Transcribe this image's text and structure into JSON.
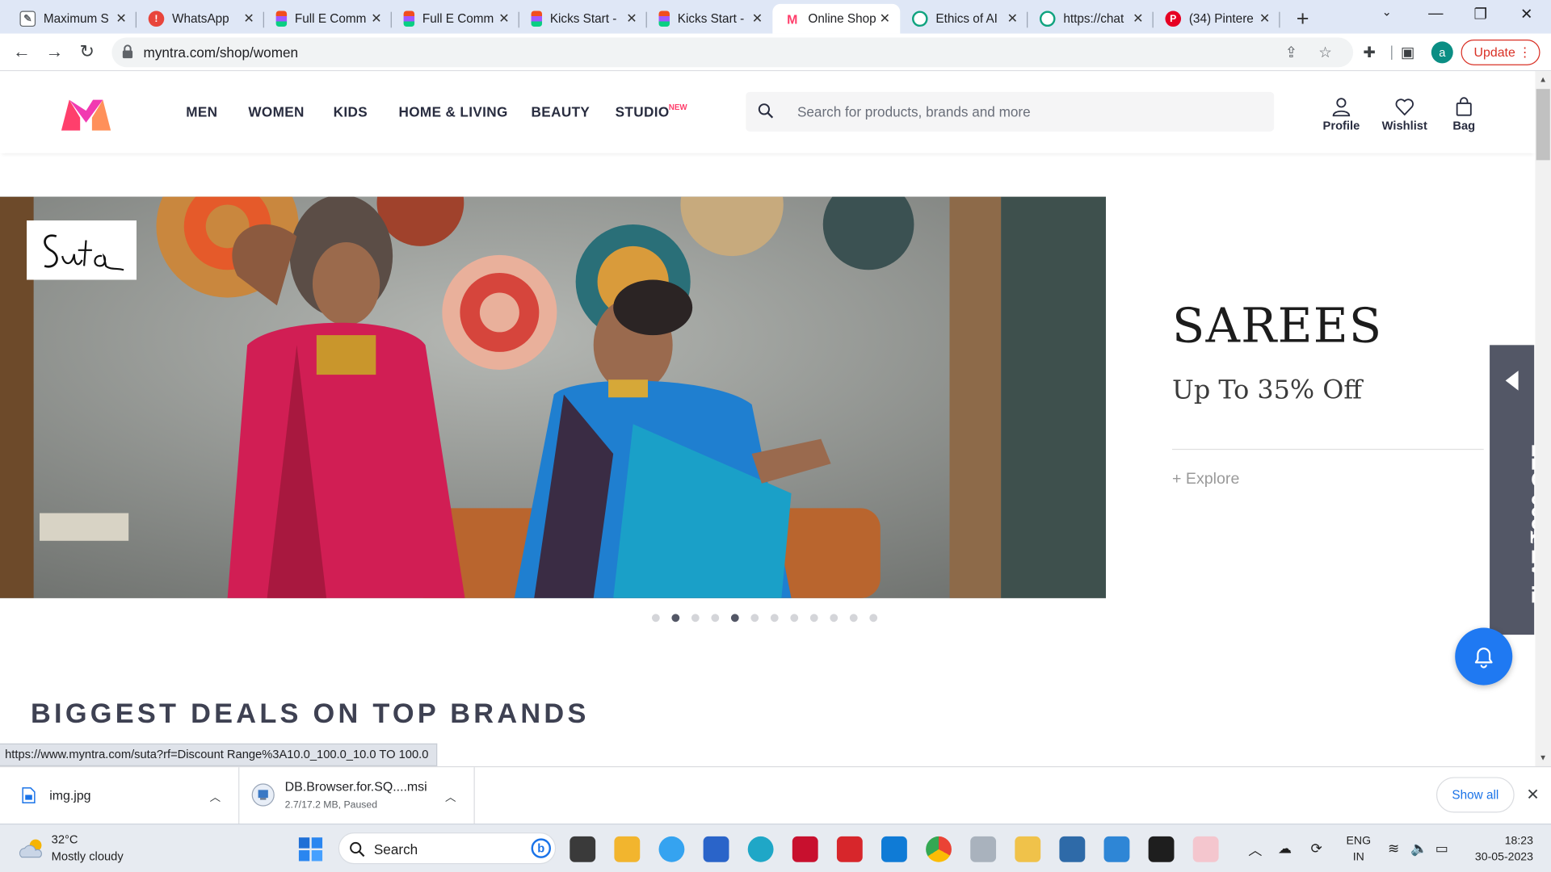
{
  "browser": {
    "tabs": [
      {
        "label": "Maximum S",
        "icon": "fountain-pen-icon",
        "color": "#5f6368"
      },
      {
        "label": "WhatsApp",
        "icon": "whatsapp-alert-icon",
        "color": "#e8453c"
      },
      {
        "label": "Full E Comm",
        "icon": "figma-icon",
        "color": "#f24e1e"
      },
      {
        "label": "Full E Comm",
        "icon": "figma-icon",
        "color": "#f24e1e"
      },
      {
        "label": "Kicks Start -",
        "icon": "figma-icon",
        "color": "#f24e1e"
      },
      {
        "label": "Kicks Start -",
        "icon": "figma-icon",
        "color": "#f24e1e"
      },
      {
        "label": "Online Shop",
        "icon": "myntra-icon",
        "color": "#ff3f6c",
        "active": true
      },
      {
        "label": "Ethics of AI",
        "icon": "openai-icon",
        "color": "#10a37f"
      },
      {
        "label": "https://chat",
        "icon": "openai-icon",
        "color": "#10a37f"
      },
      {
        "label": "(34) Pintere",
        "icon": "pinterest-icon",
        "color": "#e60023"
      }
    ],
    "url": "myntra.com/shop/women",
    "profile_initial": "a",
    "update_label": "Update"
  },
  "site": {
    "nav": [
      "MEN",
      "WOMEN",
      "KIDS",
      "HOME & LIVING",
      "BEAUTY",
      "STUDIO"
    ],
    "nav_badge": "NEW",
    "search_placeholder": "Search for products, brands and more",
    "profile_label": "Profile",
    "wishlist_label": "Wishlist",
    "bag_label": "Bag",
    "accent": "#ff3f6c"
  },
  "hero": {
    "brand_logo_text": "Suta",
    "title": "SAREES",
    "subtitle": "Up To 35% Off",
    "cta": "+ Explore",
    "slide_count": 12,
    "active_slide": 5,
    "visited_slide": 2
  },
  "offer": {
    "text": "FLAT ₹200 OFF"
  },
  "section": {
    "heading": "BIGGEST DEALS ON TOP BRANDS"
  },
  "status_url": "https://www.myntra.com/suta?rf=Discount Range%3A10.0_100.0_10.0 TO 100.0",
  "downloads": [
    {
      "name": "img.jpg",
      "detail": ""
    },
    {
      "name": "DB.Browser.for.SQ....msi",
      "detail": "2.7/17.2 MB, Paused"
    }
  ],
  "show_all_label": "Show all",
  "taskbar": {
    "temperature": "32°C",
    "weather": "Mostly cloudy",
    "search_label": "Search",
    "lang_1": "ENG",
    "lang_2": "IN",
    "time": "18:23",
    "date": "30-05-2023"
  }
}
